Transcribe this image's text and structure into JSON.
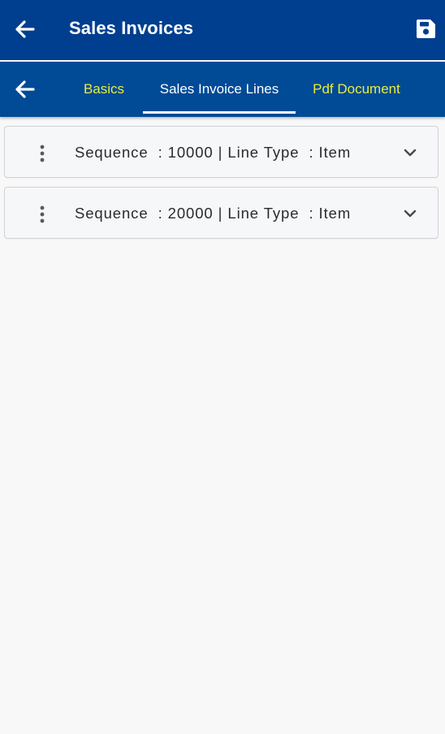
{
  "app_bar": {
    "back_icon": "arrow-left-icon",
    "title": "Sales Invoices",
    "save_icon": "floppy-disk-icon",
    "background": "#003f8f"
  },
  "tab_bar": {
    "back_icon": "arrow-left-icon",
    "background": "#004a96",
    "active_color": "#ffffff",
    "inactive_color": "#e6ee3c",
    "tabs": [
      {
        "label": "Basics",
        "active": false
      },
      {
        "label": "Sales Invoice Lines",
        "active": true
      },
      {
        "label": "Pdf Document",
        "active": false
      }
    ]
  },
  "invoice_lines": [
    {
      "text": "Sequence  : 10000 | Line Type  : Item",
      "menu_icon": "more-vertical-icon",
      "expand_icon": "chevron-down-icon"
    },
    {
      "text": "Sequence  : 20000 | Line Type  : Item",
      "menu_icon": "more-vertical-icon",
      "expand_icon": "chevron-down-icon"
    }
  ]
}
